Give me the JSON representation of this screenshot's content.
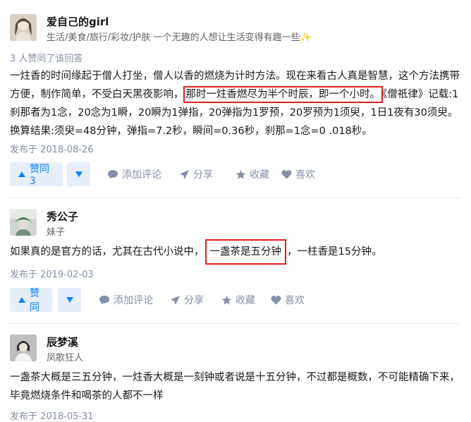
{
  "answers": [
    {
      "author_name": "爱自己的girl",
      "author_headline": "生活/美食/旅行/彩妆/护肤 一个无趣的人想让生活变得有趣一些✨",
      "voters": "3 人赞同了该回答",
      "content": {
        "part1": "一炷香的时间缘起于僧人打坐，僧人以香的燃烧为计时方法。现在来看古人真是智慧，这个方法携带方便，制作简单，不受白天黑夜影响，",
        "highlight": "那时一炷香燃尽为半个时辰，即一个小时。",
        "part2": "《僧祇律》记载:1刹那者为1念，20念为1瞬，20瞬为1弹指，20弹指为1罗预，20罗预为1须臾，1日1夜有30须臾。换算结果:须臾=48分钟，弹指=7.2秒，瞬间=0.36秒，刹那=1念=0 .018秒。"
      },
      "date": "发布于 2018-08-26",
      "vote_label": "赞同 3"
    },
    {
      "author_name": "秀公子",
      "author_headline": "妹子",
      "content": {
        "part1": "如果真的是官方的话，尤其在古代小说中，",
        "highlight": "一盏茶是五分钟",
        "part2": "，一柱香是15分钟。"
      },
      "date": "发布于 2019-02-03",
      "vote_label": "赞同"
    },
    {
      "author_name": "辰梦溪",
      "author_headline": "凤歌狂人",
      "content": {
        "part1": "一盏茶大概是三五分钟，一炷香大概是一刻钟或者说是十五分钟，不过都是概数，不可能精确下来，毕竟燃烧条件和喝茶的人都不一样"
      },
      "date": "发布于 2018-05-31"
    }
  ],
  "actions": {
    "comment": "添加评论",
    "share": "分享",
    "favorite": "收藏",
    "like": "喜欢"
  },
  "icons": [
    "caret-up-icon",
    "caret-down-icon",
    "comment-icon",
    "share-icon",
    "star-icon",
    "heart-icon"
  ],
  "colors": {
    "vote_blue": "#0a84ff",
    "vote_bg": "#e5eefa",
    "highlight_red": "#e01f1f",
    "meta_gray": "#8590a6"
  }
}
